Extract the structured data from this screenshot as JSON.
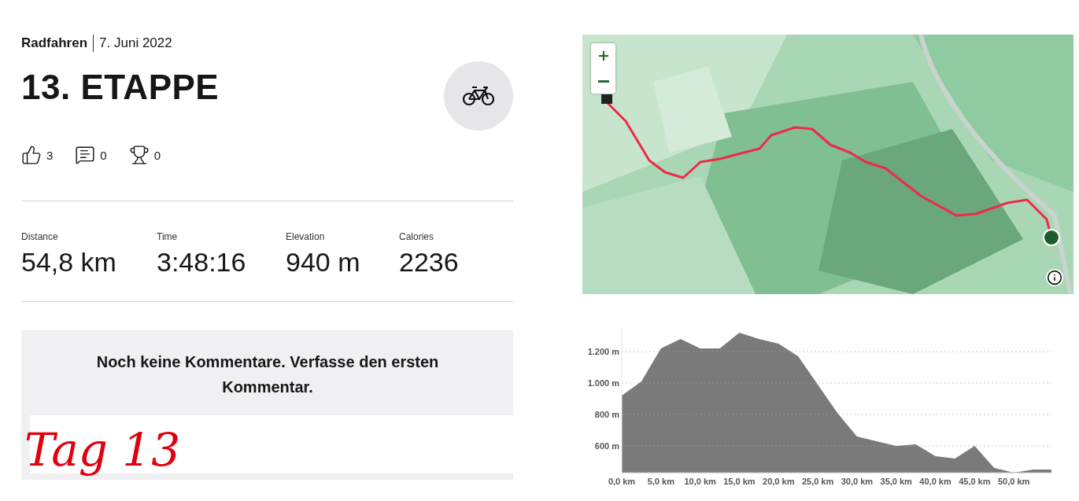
{
  "activity": {
    "sport": "Radfahren",
    "date": "7. Juni 2022",
    "title": "13. ETAPPE"
  },
  "reactions": [
    {
      "kind": "likes",
      "count": "3"
    },
    {
      "kind": "comments",
      "count": "0"
    },
    {
      "kind": "trophies",
      "count": "0"
    }
  ],
  "stats": [
    {
      "label": "Distance",
      "value": "54,8 km"
    },
    {
      "label": "Time",
      "value": "3:48:16"
    },
    {
      "label": "Elevation",
      "value": "940 m"
    },
    {
      "label": "Calories",
      "value": "2236"
    }
  ],
  "comments": {
    "empty_message": "Noch keine Kommentare. Verfasse den ersten Kommentar."
  },
  "annotation": "Tag 13",
  "elevation": {
    "chart_data": {
      "type": "area",
      "grid": true,
      "xlim": [
        0,
        54.8
      ],
      "ylim": [
        430,
        1350
      ],
      "x": [
        0,
        2.5,
        5,
        7.5,
        10,
        12.5,
        15,
        17.5,
        20,
        22.5,
        25,
        27.5,
        30,
        32.5,
        35,
        37.5,
        40,
        42.5,
        45,
        47.5,
        50,
        52.5,
        54.8
      ],
      "series": [
        {
          "color": "#7a7a7a",
          "values": [
            920,
            1010,
            1220,
            1280,
            1220,
            1220,
            1320,
            1280,
            1250,
            1170,
            990,
            810,
            660,
            630,
            600,
            610,
            535,
            520,
            600,
            460,
            430,
            450,
            450
          ]
        }
      ],
      "xticks": [
        {
          "value": 0,
          "label": "0,0 km"
        },
        {
          "value": 5,
          "label": "5,0 km"
        },
        {
          "value": 10,
          "label": "10,0 km"
        },
        {
          "value": 15,
          "label": "15,0 km"
        },
        {
          "value": 20,
          "label": "20,0 km"
        },
        {
          "value": 25,
          "label": "25,0 km"
        },
        {
          "value": 30,
          "label": "30,0 km"
        },
        {
          "value": 35,
          "label": "35,0 km"
        },
        {
          "value": 40,
          "label": "40,0 km"
        },
        {
          "value": 45,
          "label": "45,0 km"
        },
        {
          "value": 50,
          "label": "50,0 km"
        }
      ],
      "yticks": [
        {
          "value": 600,
          "label": "600 m"
        },
        {
          "value": 800,
          "label": "800 m"
        },
        {
          "value": 1000,
          "label": "1.000 m"
        },
        {
          "value": 1200,
          "label": "1.200 m"
        }
      ]
    }
  }
}
